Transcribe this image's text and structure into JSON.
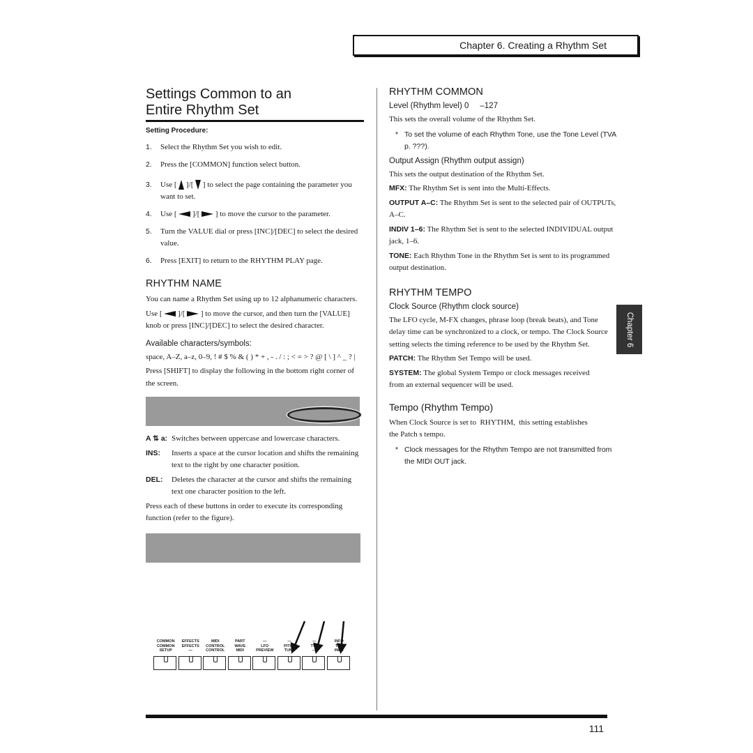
{
  "header": {
    "chapter_title": "Chapter 6. Creating a Rhythm Set"
  },
  "page_title_line1": "Settings Common to an",
  "page_title_line2": "Entire Rhythm Set",
  "left": {
    "setting_procedure_label": "Setting Procedure:",
    "steps": [
      {
        "num": "1.",
        "text": "Select the Rhythm Set you wish to edit."
      },
      {
        "num": "2.",
        "text": "Press the [COMMON] function select button."
      },
      {
        "num": "3.",
        "pre": "Use [",
        "mid": "]/[",
        "post": "] to select the page containing the parameter you want to set.",
        "icon1": "up-triangle",
        "icon2": "down-triangle"
      },
      {
        "num": "4.",
        "pre": "Use [",
        "mid": "]/[",
        "post": "] to move the cursor to the parameter.",
        "icon1": "left-arrow",
        "icon2": "right-arrow"
      },
      {
        "num": "5.",
        "text": "Turn the VALUE dial or press [INC]/[DEC] to select the desired value."
      },
      {
        "num": "6.",
        "text": "Press [EXIT] to return to the RHYTHM PLAY page."
      }
    ],
    "rhythm_name": {
      "heading": "RHYTHM NAME",
      "intro": "You can name a Rhythm Set using up to 12 alphanumeric characters.",
      "use_pre": "Use [",
      "use_mid": "]/[",
      "use_post": "] to move the cursor, and then turn the [VALUE] knob or press [INC]/[DEC] to select the desired character.",
      "chars_heading": "Available characters/symbols:",
      "chars_line": "space, A–Z, a–z, 0–9, !   # $ % &   ( ) * + , - . / : ; < = > ? @ [ \\ ] ^ _ ? |",
      "shift_text": "Press [SHIFT] to display the following in the bottom right corner of the screen.",
      "defs": [
        {
          "key": "A ⇅ a:",
          "value": "Switches between uppercase and lowercase characters."
        },
        {
          "key": "INS:",
          "value": "Inserts a space at the cursor location and shifts the remaining text to the right by one character position."
        },
        {
          "key": "DEL:",
          "value": "Deletes the character at the cursor and shifts the remaining text one character position to the left."
        }
      ],
      "press_each": "Press each of these buttons in order to execute its corresponding function (refer to the figure)."
    },
    "softkeys": [
      {
        "l1": "COMMON",
        "l2": "COMMON",
        "l3": "SETUP"
      },
      {
        "l1": "EFFECTS",
        "l2": "EFFECTS",
        "l3": "—"
      },
      {
        "l1": "MIDI",
        "l2": "CONTROL",
        "l3": "CONTROL"
      },
      {
        "l1": "PART",
        "l2": "WAVE",
        "l3": "MIDI"
      },
      {
        "l1": "—",
        "l2": "LFO",
        "l3": "PREVIEW"
      },
      {
        "l1": "—",
        "l2": "PITCH",
        "l3": "TUNE"
      },
      {
        "l1": "—",
        "l2": "TVF",
        "l3": "—"
      },
      {
        "l1": "INFO",
        "l2": "TVA",
        "l3": "INFO"
      }
    ]
  },
  "right": {
    "rhythm_common": {
      "heading": "RHYTHM COMMON",
      "level_heading": "Level (Rhythm level) 0     –127",
      "level_text": "This sets the overall volume of the Rhythm Set.",
      "level_note": "To set the volume of each Rhythm Tone, use the Tone Level (TVA p. ???).",
      "output_heading": "Output Assign (Rhythm output assign)",
      "output_text": "This sets the output destination of the Rhythm Set.",
      "output_opts": [
        {
          "key": "MFX:",
          "text": "The Rhythm Set is sent into the Multi-Effects."
        },
        {
          "key": "OUTPUT A–C:",
          "text": "The Rhythm Set is sent to the selected pair of OUTPUTs, A–C."
        },
        {
          "key": "INDIV 1–6:",
          "text": "The Rhythm Set is sent to the selected INDIVIDUAL output jack, 1–6."
        },
        {
          "key": "TONE:",
          "text": "Each Rhythm Tone in the Rhythm Set is sent to its programmed output destination."
        }
      ]
    },
    "rhythm_tempo": {
      "heading": "RHYTHM TEMPO",
      "clock_heading": "Clock Source (Rhythm clock source)",
      "clock_text": "The LFO cycle, M-FX changes, phrase loop (break beats), and Tone delay time can be synchronized to a clock, or tempo. The Clock Source setting selects the timing reference to be used by the Rhythm Set.",
      "clock_opts": [
        {
          "key": "PATCH:",
          "text": "The Rhythm Set Tempo will be used."
        },
        {
          "key": "SYSTEM:",
          "text": "The global System Tempo or clock messages received from an external sequencer will be used."
        }
      ],
      "tempo_heading": "Tempo (Rhythm Tempo)",
      "tempo_text": "When Clock Source is set to  RHYTHM,  this setting establishes the Patch s tempo.",
      "tempo_note": "Clock messages for the Rhythm Tempo are not transmitted from the MIDI OUT jack."
    }
  },
  "side_tab": "Chapter 6",
  "note_star": "*",
  "page_number": "111"
}
